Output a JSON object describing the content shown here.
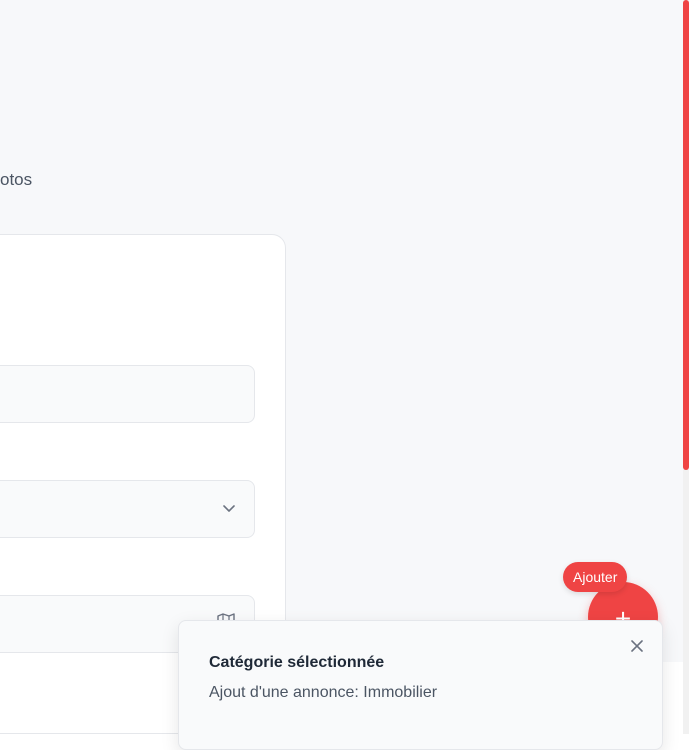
{
  "steps": {
    "current_label": "otos"
  },
  "fab": {
    "badge_label": "Ajouter",
    "icon": "plus-icon",
    "color": "#ef4444"
  },
  "toast": {
    "title": "Catégorie sélectionnée",
    "message": "Ajout d'une annonce: Immobilier",
    "close_icon": "close-icon"
  },
  "form": {
    "fields": [
      {
        "value": ""
      },
      {
        "value": "",
        "icon": "chevron-down-icon"
      },
      {
        "value": "",
        "icon": "map-icon"
      }
    ]
  },
  "colors": {
    "accent": "#ef4444",
    "background": "#f7f8fa",
    "card": "#ffffff"
  }
}
